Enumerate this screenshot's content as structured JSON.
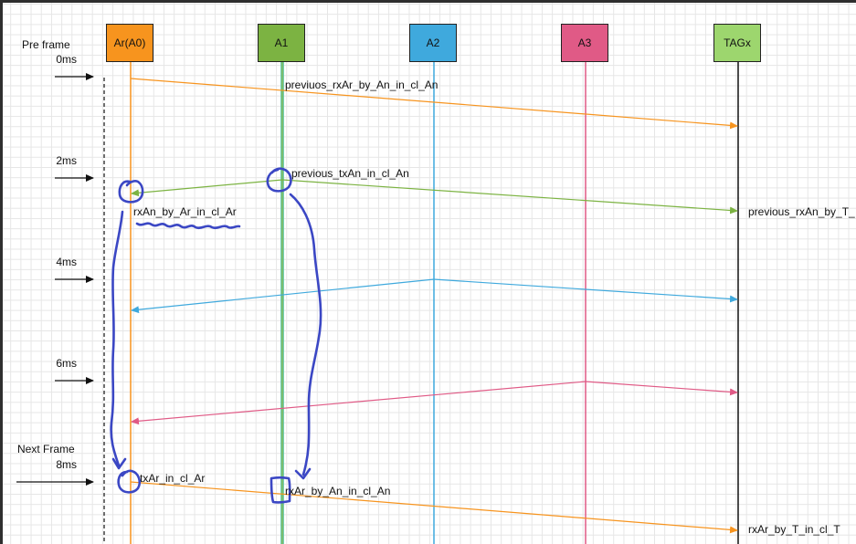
{
  "participants": [
    {
      "label": "Ar(A0)",
      "fill": "#f7941e"
    },
    {
      "label": "A1",
      "fill": "#7cb342"
    },
    {
      "label": "A2",
      "fill": "#3fa9dd"
    },
    {
      "label": "A3",
      "fill": "#e05a86"
    },
    {
      "label": "TAGx",
      "fill": "#9dd66e"
    }
  ],
  "time_labels": {
    "pre_frame": "Pre frame",
    "t0": "0ms",
    "t2": "2ms",
    "t4": "4ms",
    "t6": "6ms",
    "next_frame": "Next Frame",
    "t8": "8ms"
  },
  "messages": {
    "m1": "previuos_rxAr_by_An_in_cl_An",
    "m2": "previous_txAn_in_cl_An",
    "m3": "previous_rxAn_by_T_",
    "m4": "rxAn_by_Ar_in_cl_Ar",
    "m5": "txAr_in_cl_Ar",
    "m6": "rxAr_by_An_in_cl_An",
    "m7": "rxAr_by_T_in_cl_T"
  },
  "colors": {
    "orange": "#f7941e",
    "green": "#7cb342",
    "teal": "#5fc7a8",
    "blue": "#3fa9dd",
    "pink": "#e05a86",
    "ink": "#3b47c4"
  }
}
